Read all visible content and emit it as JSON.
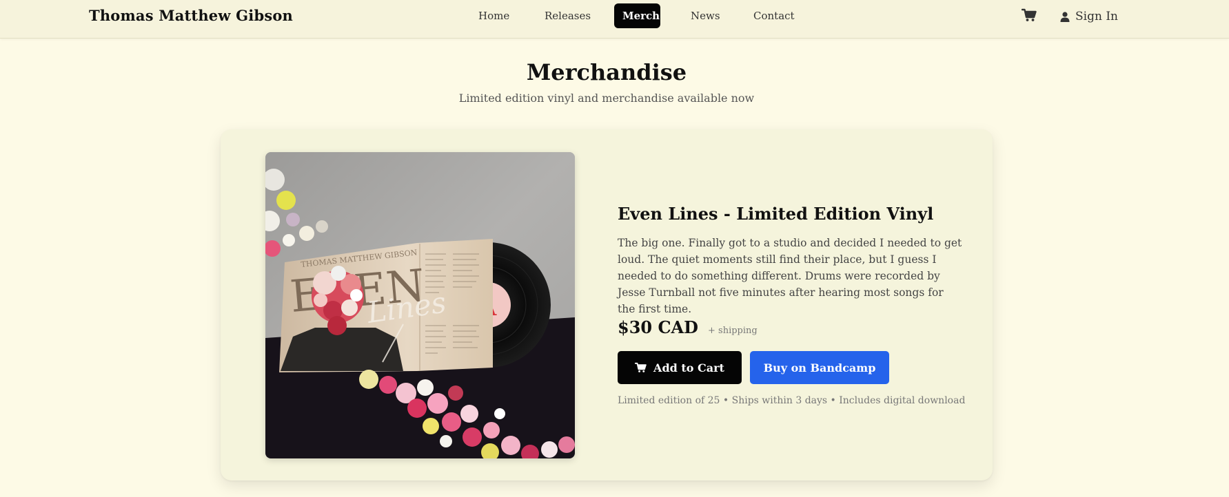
{
  "brand": "Thomas Matthew Gibson",
  "nav": {
    "items": [
      {
        "label": "Home",
        "active": false
      },
      {
        "label": "Releases",
        "active": false
      },
      {
        "label": "Merch",
        "active": true
      },
      {
        "label": "News",
        "active": false
      },
      {
        "label": "Contact",
        "active": false
      }
    ],
    "cart_icon": "cart-icon",
    "signin_icon": "user-icon",
    "signin_label": "Sign In"
  },
  "header": {
    "title": "Merchandise",
    "subtitle": "Limited edition vinyl and merchandise available now"
  },
  "product": {
    "image_alt": "Even Lines vinyl record with album sleeve",
    "cover_artist": "THOMAS MATTHEW GIBSON",
    "cover_title": "EVEN",
    "cover_script": "Lines",
    "title": "Even Lines - Limited Edition Vinyl",
    "description": "The big one. Finally got to a studio and decided I needed to get loud. The quiet moments still find their place, but I guess I needed to do something different. Drums were recorded by Jesse Turnball not five minutes after hearing most songs for the first time.",
    "price": "$30 CAD",
    "shipping": "+ shipping",
    "add_to_cart": "Add to Cart",
    "buy_bandcamp": "Buy on Bandcamp",
    "details": "Limited edition of 25 • Ships within 3 days • Includes digital download"
  },
  "colors": {
    "background": "#fdfae6",
    "nav_bg": "#f6f3dc",
    "card_bg": "#f5f4dc",
    "active_nav": "#050505",
    "bandcamp_blue": "#2563eb"
  }
}
